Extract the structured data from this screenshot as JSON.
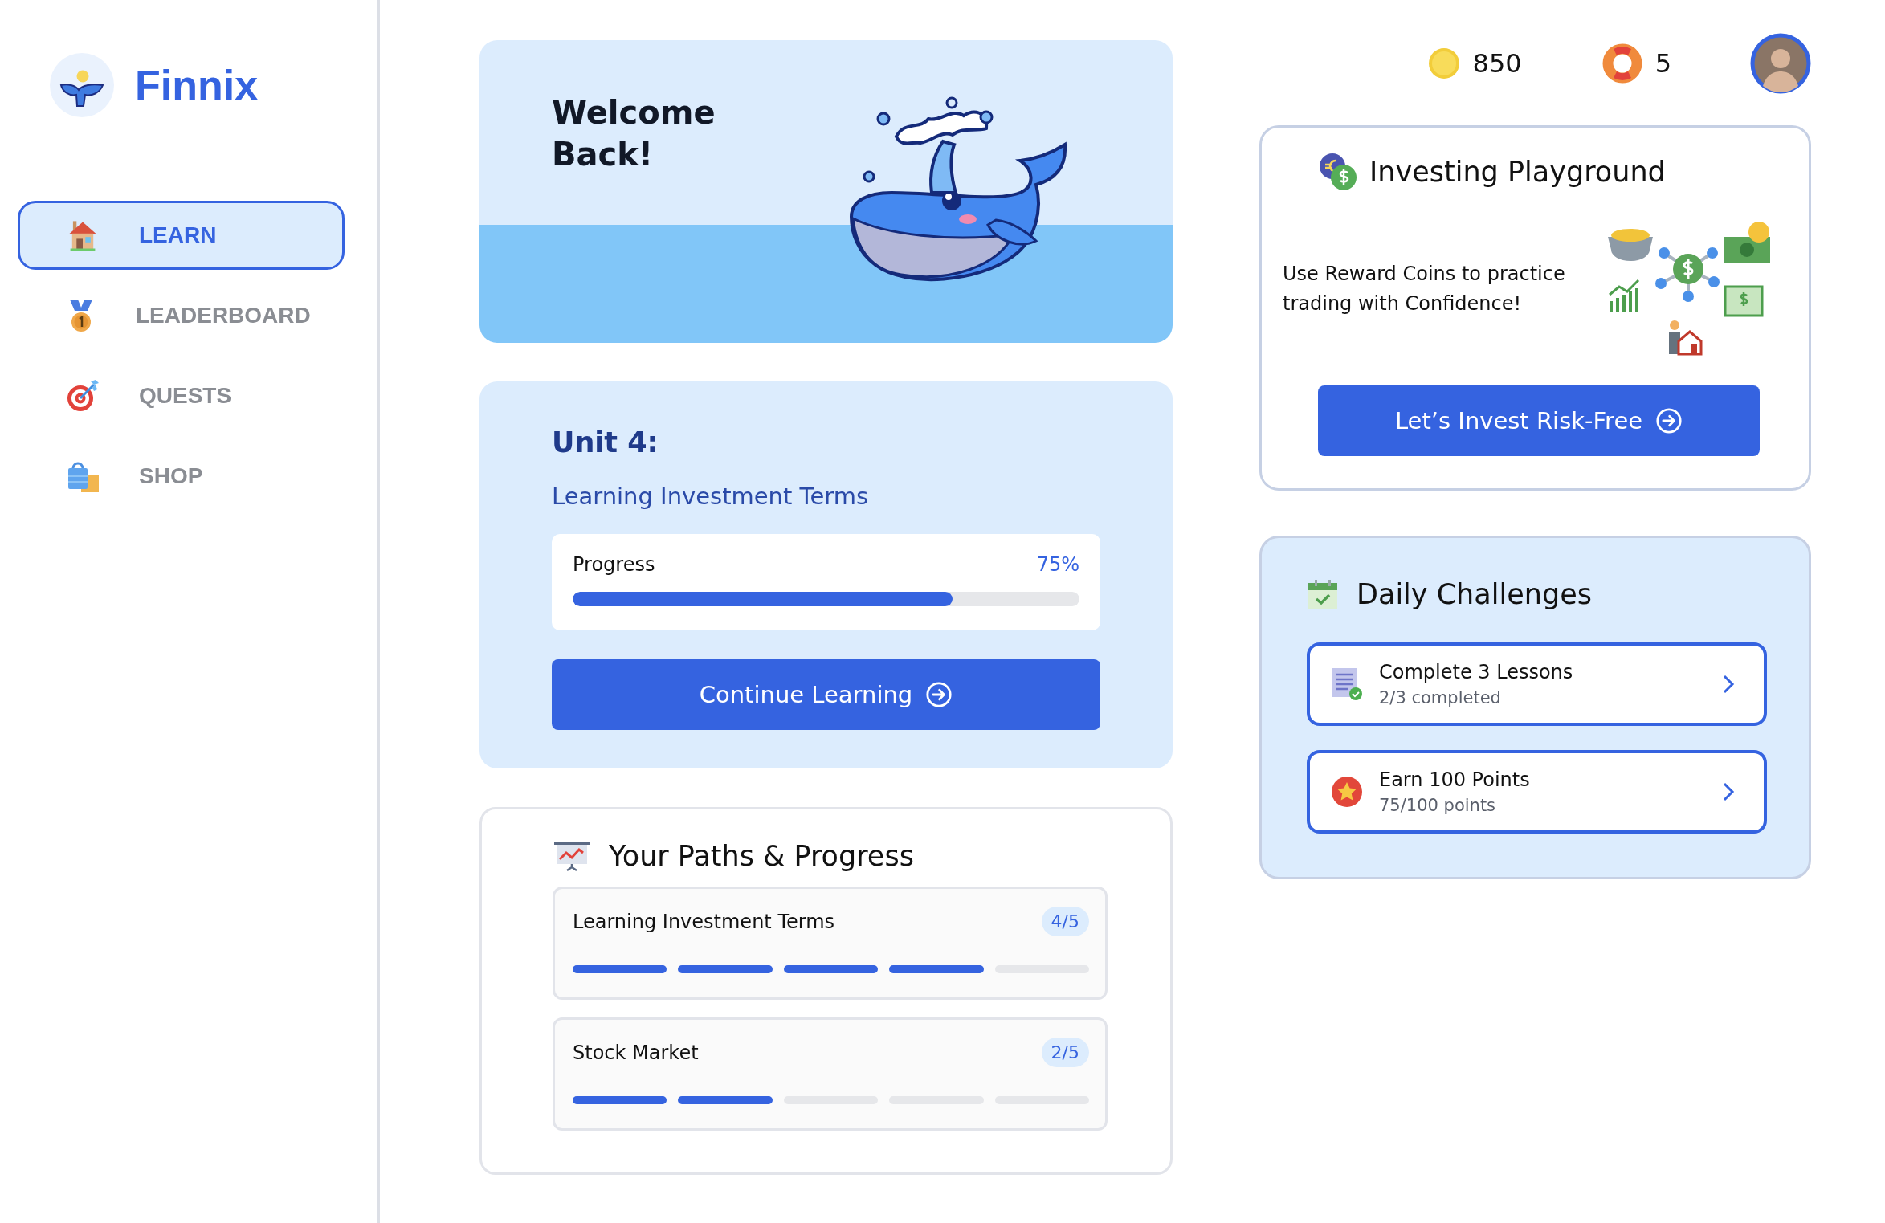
{
  "brand": {
    "name": "Finnix"
  },
  "nav": [
    {
      "label": "LEARN",
      "kind": "house",
      "selected": true
    },
    {
      "label": "LEADERBOARD",
      "kind": "medal",
      "selected": false
    },
    {
      "label": "QUESTS",
      "kind": "target",
      "selected": false
    },
    {
      "label": "SHOP",
      "kind": "bag",
      "selected": false
    }
  ],
  "welcome": {
    "title": "Welcome Back!"
  },
  "unit": {
    "title": "Unit 4:",
    "subtitle": "Learning Investment Terms",
    "progress": {
      "label": "Progress",
      "reading": "75%",
      "level": 0.75
    },
    "button": "Continue Learning"
  },
  "paths": {
    "title": "Your Paths & Progress",
    "items": [
      {
        "name": "Learning Investment Terms",
        "count": "4/5",
        "level": 0.8
      },
      {
        "name": "Stock Market",
        "count": "2/5",
        "level": 0.4
      }
    ]
  },
  "stats": {
    "coins": "850",
    "lives": "5"
  },
  "playground": {
    "title": "Investing Playground",
    "text": "Use Reward Coins to practice trading with Confidence!",
    "button": "Let’s Invest Risk-Free"
  },
  "daily": {
    "title": "Daily Challenges",
    "items": [
      {
        "kind": "lessons",
        "title": "Complete 3 Lessons",
        "status": "2/3 completed"
      },
      {
        "kind": "points",
        "title": "Earn 100 Points",
        "status": "75/100 points"
      }
    ]
  }
}
